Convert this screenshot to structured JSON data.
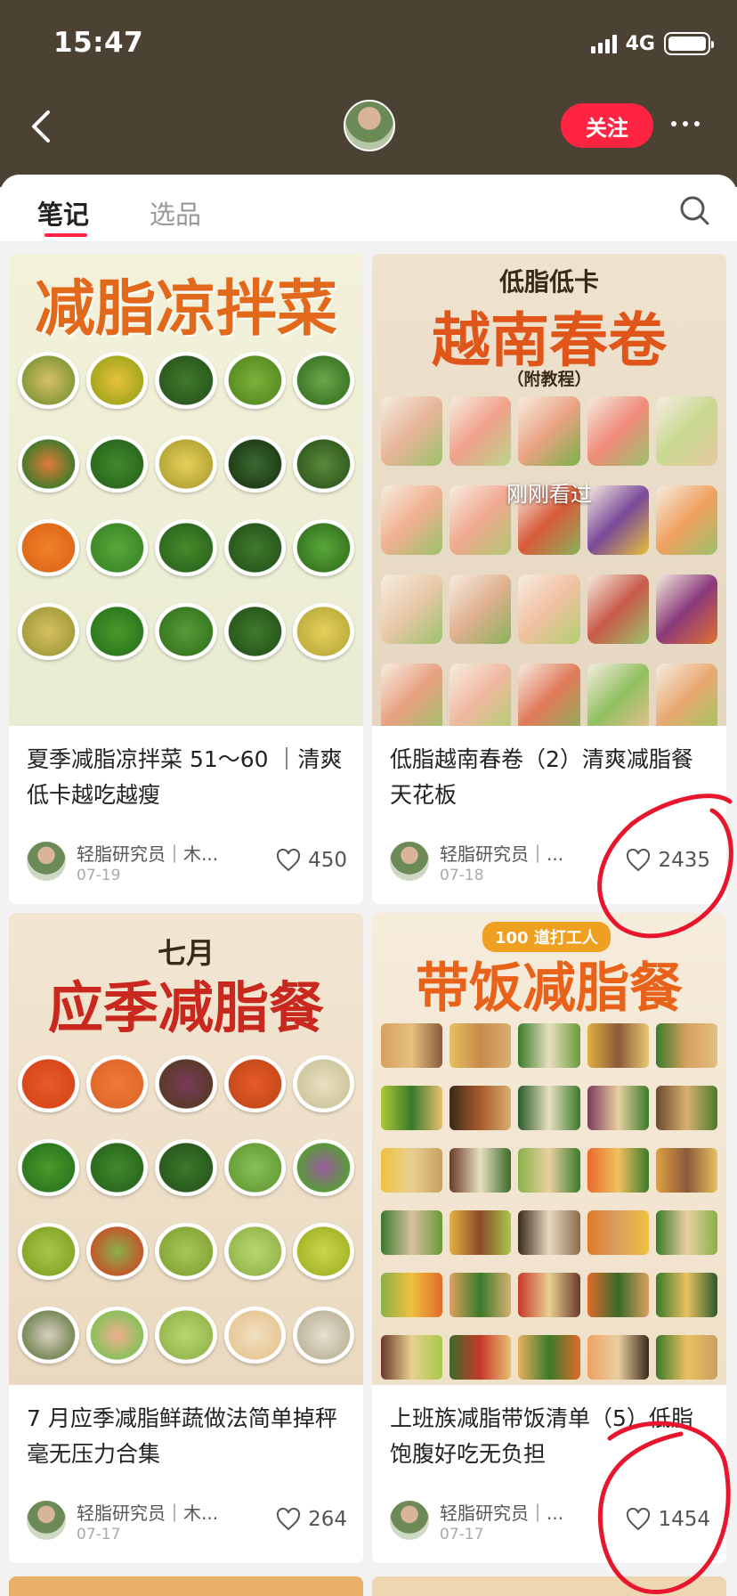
{
  "status": {
    "time": "15:47",
    "network": "4G"
  },
  "header": {
    "follow_label": "关注"
  },
  "tabs": {
    "notes": "笔记",
    "picks": "选品"
  },
  "cards": [
    {
      "cover_title": "减脂凉拌菜",
      "title": "夏季减脂凉拌菜 51～60 ｜清爽低卡越吃越瘦",
      "author": "轻脂研究员｜木...",
      "date": "07-19",
      "likes": "450"
    },
    {
      "cover_sub": "低脂低卡",
      "cover_title": "越南春卷",
      "cover_note": "（附教程）",
      "seen_label": "刚刚看过",
      "title": "低脂越南春卷（2）清爽减脂餐天花板",
      "author": "轻脂研究员｜...",
      "date": "07-18",
      "likes": "2435"
    },
    {
      "cover_sub": "七月",
      "cover_title": "应季减脂餐",
      "title": "7 月应季减脂鲜蔬做法简单掉秤毫无压力合集",
      "author": "轻脂研究员｜木...",
      "date": "07-17",
      "likes": "264"
    },
    {
      "cover_badge": "100 道打工人",
      "cover_title": "带饭减脂餐",
      "title": "上班族减脂带饭清单（5）低脂饱腹好吃无负担",
      "author": "轻脂研究员｜...",
      "date": "07-17",
      "likes": "1454"
    }
  ],
  "colors": {
    "accent": "#ff2442",
    "header_bg": "#4c4233",
    "annotation": "#e8162d"
  }
}
